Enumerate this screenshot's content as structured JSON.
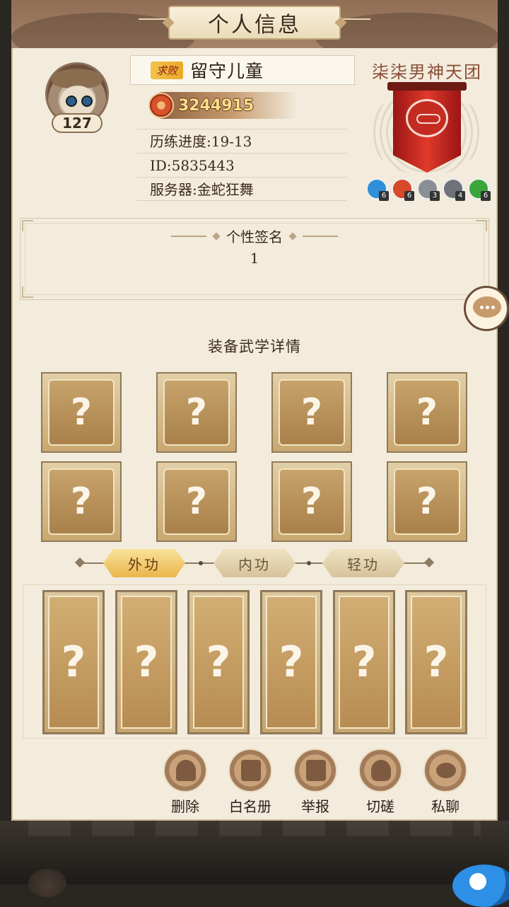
{
  "window": {
    "title": "个人信息"
  },
  "profile": {
    "level": "127",
    "badge": "求败",
    "name": "留守儿童",
    "power": "3244915",
    "progress": "历练进度:19-13",
    "id": "ID:5835443",
    "server": "服务器:金蛇狂舞"
  },
  "guild": {
    "name": "柒柒男神天团",
    "gems": [
      {
        "count": "6",
        "color": "#2f8fd8"
      },
      {
        "count": "6",
        "color": "#d8482a"
      },
      {
        "count": "3",
        "color": "#8a8f96"
      },
      {
        "count": "4",
        "color": "#6e737a"
      },
      {
        "count": "6",
        "color": "#3aa63a"
      }
    ]
  },
  "signature": {
    "title": "个性签名",
    "text": "1"
  },
  "equip": {
    "title": "装备武学详情",
    "slots": [
      "?",
      "?",
      "?",
      "?",
      "?",
      "?",
      "?",
      "?"
    ],
    "tabs": [
      "外功",
      "内功",
      "轻功"
    ],
    "active_tab": "外功",
    "cards": [
      "?",
      "?",
      "?",
      "?",
      "?",
      "?"
    ]
  },
  "actions": [
    {
      "label": "删除",
      "icon": "delete-person-icon"
    },
    {
      "label": "白名册",
      "icon": "whitelist-book-icon"
    },
    {
      "label": "举报",
      "icon": "report-book-icon"
    },
    {
      "label": "切磋",
      "icon": "spar-fist-icon"
    },
    {
      "label": "私聊",
      "icon": "private-chat-icon"
    }
  ],
  "colors": {
    "panel": "#f3ecdd",
    "accent": "#c7a36b",
    "banner": "#d8332a"
  }
}
